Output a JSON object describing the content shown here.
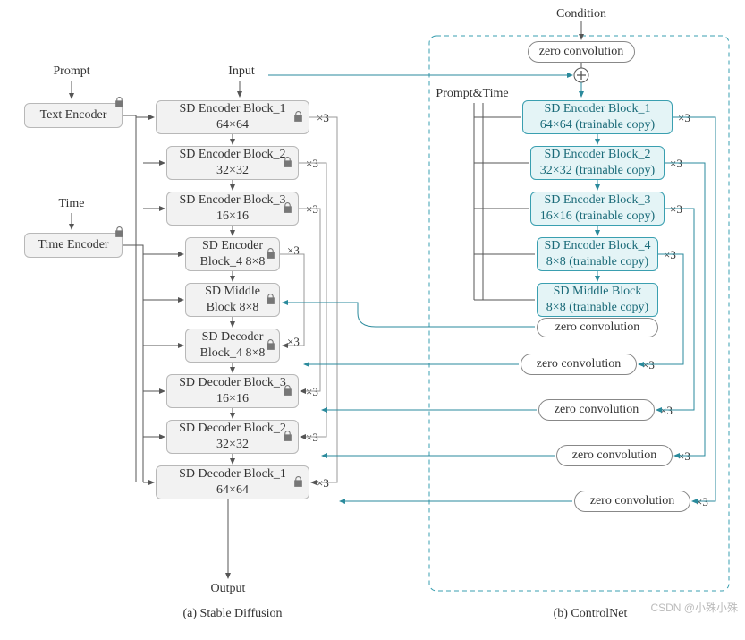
{
  "top": {
    "condition": "Condition",
    "prompt": "Prompt",
    "input": "Input",
    "time": "Time",
    "prompt_time": "Prompt&Time",
    "output": "Output"
  },
  "zero_conv": "zero convolution",
  "sd": {
    "text_encoder": "Text Encoder",
    "time_encoder": "Time Encoder",
    "enc1_l1": "SD Encoder Block_1",
    "enc1_l2": "64×64",
    "enc2_l1": "SD Encoder Block_2",
    "enc2_l2": "32×32",
    "enc3_l1": "SD Encoder Block_3",
    "enc3_l2": "16×16",
    "enc4_l1": "SD Encoder",
    "enc4_l2": "Block_4 8×8",
    "mid_l1": "SD Middle",
    "mid_l2": "Block 8×8",
    "dec4_l1": "SD Decoder",
    "dec4_l2": "Block_4 8×8",
    "dec3_l1": "SD Decoder Block_3",
    "dec3_l2": "16×16",
    "dec2_l1": "SD Decoder Block_2",
    "dec2_l2": "32×32",
    "dec1_l1": "SD Decoder Block_1",
    "dec1_l2": "64×64"
  },
  "cn": {
    "enc1_l1": "SD Encoder Block_1",
    "enc1_l2": "64×64 (trainable copy)",
    "enc2_l1": "SD Encoder Block_2",
    "enc2_l2": "32×32 (trainable copy)",
    "enc3_l1": "SD Encoder Block_3",
    "enc3_l2": "16×16 (trainable copy)",
    "enc4_l1": "SD Encoder Block_4",
    "enc4_l2": "8×8 (trainable copy)",
    "mid_l1": "SD Middle Block",
    "mid_l2": "8×8 (trainable copy)"
  },
  "x3": "×3",
  "captions": {
    "a": "(a) Stable Diffusion",
    "b": "(b) ControlNet"
  },
  "watermark": "CSDN @小殊小殊"
}
